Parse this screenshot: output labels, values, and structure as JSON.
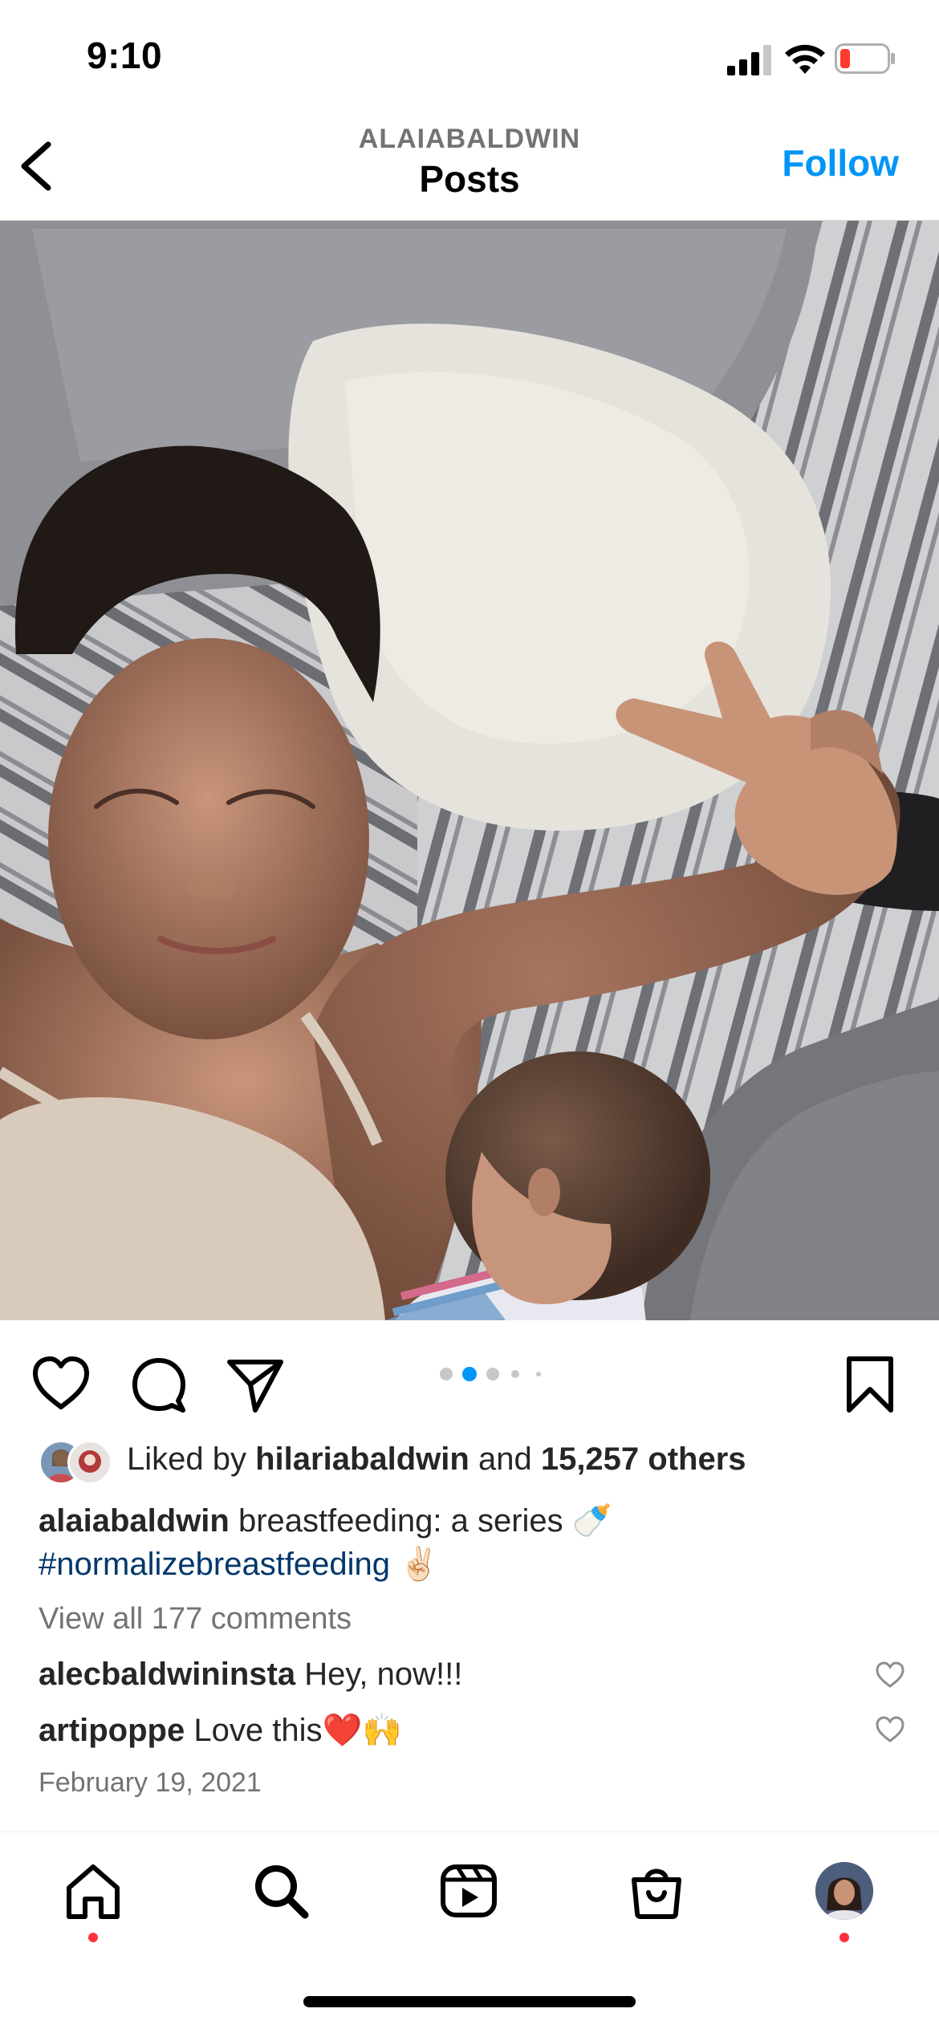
{
  "status_bar": {
    "time": "9:10",
    "battery_color": "#ff3b30"
  },
  "header": {
    "username": "ALAIABALDWIN",
    "title": "Posts",
    "follow_label": "Follow",
    "back_icon": "chevron-left-icon"
  },
  "post": {
    "carousel": {
      "total": 5,
      "active": 2
    },
    "liked_by": {
      "prefix": "Liked by",
      "user": "hilariabaldwin",
      "conjunction": "and",
      "others": "15,257 others"
    },
    "caption": {
      "username": "alaiabaldwin",
      "text": "breastfeeding: a series",
      "emoji1": "🍼",
      "hashtag": "#normalizebreastfeeding",
      "emoji2": "✌🏻"
    },
    "view_comments": "View all 177 comments",
    "comments": [
      {
        "username": "alecbaldwininsta",
        "text": "Hey, now!!!"
      },
      {
        "username": "artipoppe",
        "text": "Love this",
        "emoji": "❤️🙌"
      }
    ],
    "date": "February 19, 2021"
  },
  "tab_bar": {
    "items": [
      "home-icon",
      "search-icon",
      "reels-icon",
      "shop-icon",
      "profile-avatar"
    ],
    "notification_color": "#ff3040"
  },
  "colors": {
    "accent": "#0095f6",
    "hashtag": "#00376b",
    "muted": "#737373"
  }
}
